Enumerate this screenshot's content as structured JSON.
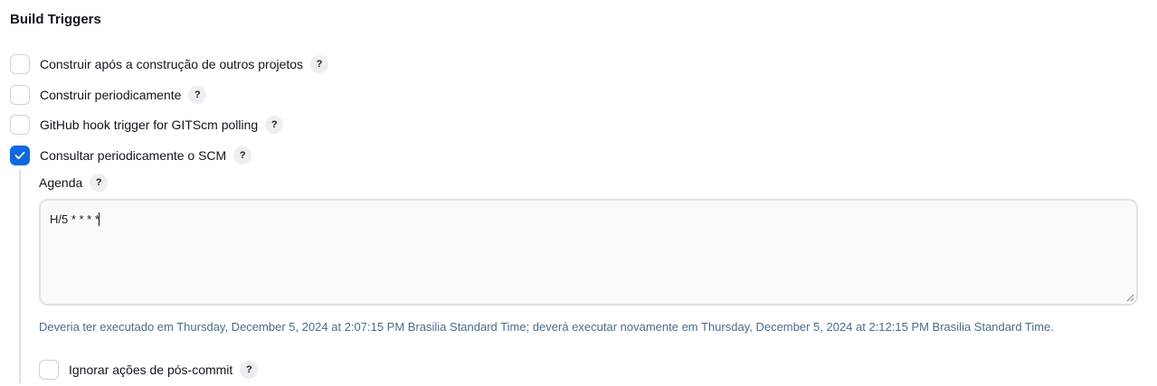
{
  "section": {
    "title": "Build Triggers"
  },
  "triggers": [
    {
      "label": "Construir após a construção de outros projetos",
      "checked": false,
      "help": "?"
    },
    {
      "label": "Construir periodicamente",
      "checked": false,
      "help": "?"
    },
    {
      "label": "GitHub hook trigger for GITScm polling",
      "checked": false,
      "help": "?"
    },
    {
      "label": "Consultar periodicamente o SCM",
      "checked": true,
      "help": "?"
    }
  ],
  "scm_polling": {
    "schedule_label": "Agenda",
    "schedule_help": "?",
    "schedule_value": "H/5 * * * *",
    "schedule_info": "Deveria ter executado em Thursday, December 5, 2024 at 2:07:15 PM Brasilia Standard Time; deverá executar novamente em Thursday, December 5, 2024 at 2:12:15 PM Brasilia Standard Time.",
    "ignore_post_commit": {
      "label": "Ignorar ações de pós-commit",
      "checked": false,
      "help": "?"
    }
  },
  "colors": {
    "accent": "#1068e0",
    "info_text": "#4b6c8c",
    "help_bg": "#eceef2"
  }
}
